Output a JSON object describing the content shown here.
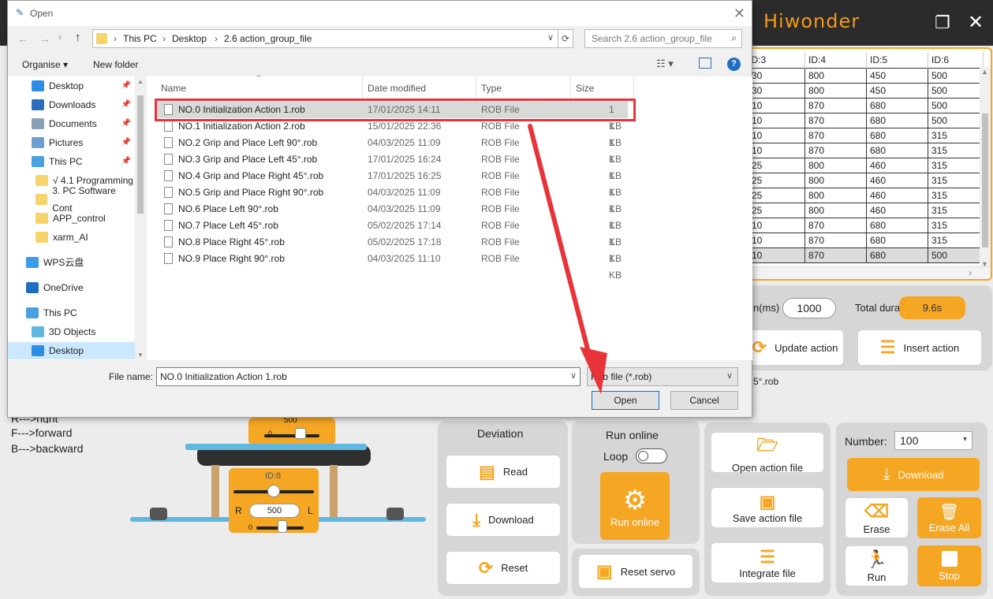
{
  "app": {
    "brand": "Hiwonder",
    "table": {
      "headers": [
        "ID:3",
        "ID:4",
        "ID:5",
        "ID:6"
      ],
      "header_partial": "D:3",
      "rows": [
        [
          "30",
          "800",
          "450",
          "500"
        ],
        [
          "30",
          "800",
          "450",
          "500"
        ],
        [
          "10",
          "870",
          "680",
          "500"
        ],
        [
          "10",
          "870",
          "680",
          "500"
        ],
        [
          "10",
          "870",
          "680",
          "315"
        ],
        [
          "10",
          "870",
          "680",
          "315"
        ],
        [
          "25",
          "800",
          "460",
          "315"
        ],
        [
          "25",
          "800",
          "460",
          "315"
        ],
        [
          "25",
          "800",
          "460",
          "315"
        ],
        [
          "25",
          "800",
          "460",
          "315"
        ],
        [
          "10",
          "870",
          "680",
          "315"
        ],
        [
          "10",
          "870",
          "680",
          "315"
        ],
        [
          "10",
          "870",
          "680",
          "500"
        ]
      ],
      "scroll_right": "›"
    },
    "time_label": "n(ms)",
    "time_value": "1000",
    "total_duration_label": "Total duration:",
    "total_duration_value": "9.6s",
    "update_action": "Update action",
    "insert_action": "Insert action",
    "file_hint": "5°.rob",
    "legend": {
      "right": "R--->right",
      "forward": "F--->forward",
      "backward": "B--->backward"
    },
    "servo": {
      "id_label": "ID:6",
      "top_value": "500",
      "left_letter": "R",
      "right_letter": "L",
      "value": "500",
      "zero": "0",
      "zero_top": "0"
    },
    "deviation": {
      "title": "Deviation",
      "read": "Read",
      "download": "Download",
      "reset": "Reset"
    },
    "run_online": {
      "title": "Run online",
      "loop": "Loop",
      "button": "Run online",
      "reset_servo": "Reset servo"
    },
    "files": {
      "open": "Open action file",
      "save": "Save action file",
      "integrate": "Integrate file"
    },
    "number_label": "Number:",
    "number_value": "100",
    "download": "Download",
    "erase": "Erase",
    "erase_all": "Erase All",
    "run": "Run",
    "stop": "Stop"
  },
  "dialog": {
    "title": "Open",
    "breadcrumb": [
      "This PC",
      "Desktop",
      "2.6 action_group_file"
    ],
    "search_placeholder": "Search 2.6 action_group_file",
    "organise": "Organise ▾",
    "new_folder": "New folder",
    "help": "?",
    "nav": [
      {
        "label": "Desktop",
        "icon": "desktop-icon",
        "pinned": true
      },
      {
        "label": "Downloads",
        "icon": "downloads-icon",
        "pinned": true
      },
      {
        "label": "Documents",
        "icon": "documents-icon",
        "pinned": true
      },
      {
        "label": "Pictures",
        "icon": "pictures-icon",
        "pinned": true
      },
      {
        "label": "This PC",
        "icon": "pc-icon",
        "pinned": true
      },
      {
        "label": "√ 4.1 Programming",
        "icon": "folder-icon",
        "pinned": false
      },
      {
        "label": "3. PC Software Cont",
        "icon": "folder-icon",
        "pinned": false
      },
      {
        "label": "APP_control",
        "icon": "folder-icon",
        "pinned": false
      },
      {
        "label": "xarm_AI",
        "icon": "folder-icon",
        "pinned": false
      },
      {
        "label": "WPS云盘",
        "icon": "cloud-icon",
        "pinned": false
      },
      {
        "label": "OneDrive",
        "icon": "onedrive-icon",
        "pinned": false
      },
      {
        "label": "This PC",
        "icon": "pc-icon",
        "pinned": false
      },
      {
        "label": "3D Objects",
        "icon": "3d-objects-icon",
        "pinned": false
      },
      {
        "label": "Desktop",
        "icon": "desktop-icon",
        "pinned": false
      }
    ],
    "columns": {
      "name": "Name",
      "date": "Date modified",
      "type": "Type",
      "size": "Size"
    },
    "files": [
      {
        "name": "NO.0 Initialization Action 1.rob",
        "date": "17/01/2025 14:11",
        "type": "ROB File",
        "size": "1 KB"
      },
      {
        "name": "NO.1 Initialization Action 2.rob",
        "date": "15/01/2025 22:36",
        "type": "ROB File",
        "size": "1 KB"
      },
      {
        "name": "NO.2 Grip and Place Left 90°.rob",
        "date": "04/03/2025 11:09",
        "type": "ROB File",
        "size": "1 KB"
      },
      {
        "name": "NO.3 Grip and Place Left 45°.rob",
        "date": "17/01/2025 16:24",
        "type": "ROB File",
        "size": "1 KB"
      },
      {
        "name": "NO.4 Grip and Place Right 45°.rob",
        "date": "17/01/2025 16:25",
        "type": "ROB File",
        "size": "1 KB"
      },
      {
        "name": "NO.5 Grip and Place Right 90°.rob",
        "date": "04/03/2025 11:09",
        "type": "ROB File",
        "size": "1 KB"
      },
      {
        "name": "NO.6 Place Left 90°.rob",
        "date": "04/03/2025 11:09",
        "type": "ROB File",
        "size": "1 KB"
      },
      {
        "name": "NO.7 Place Left 45°.rob",
        "date": "05/02/2025 17:14",
        "type": "ROB File",
        "size": "1 KB"
      },
      {
        "name": "NO.8 Place Right 45°.rob",
        "date": "05/02/2025 17:18",
        "type": "ROB File",
        "size": "1 KB"
      },
      {
        "name": "NO.9 Place Right 90°.rob",
        "date": "04/03/2025 11:10",
        "type": "ROB File",
        "size": "1 KB"
      }
    ],
    "filename_label": "File name:",
    "filename_value": "NO.0 Initialization Action 1.rob",
    "filter": "Rob file (*.rob)",
    "open": "Open",
    "cancel": "Cancel"
  },
  "colors": {
    "accent": "#f5a623",
    "highlight": "#e8333a",
    "titlebar": "#2b2b2b"
  }
}
